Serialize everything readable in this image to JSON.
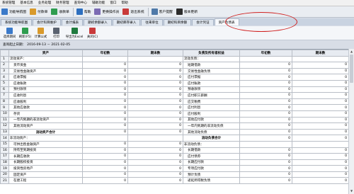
{
  "menubar": [
    "系统管理",
    "基本信息",
    "业务处理",
    "财务管理",
    "查询中心",
    "辅助功能",
    "窗口",
    "帮助"
  ],
  "toolbar": [
    {
      "name": "function-navigation-button",
      "label": "功能导航图",
      "icon": "grid-icon",
      "color": "#3a79c9"
    },
    {
      "name": "payment-button",
      "label": "付款单",
      "icon": "money-out-icon",
      "color": "#d99a2b"
    },
    {
      "name": "receipt-button",
      "label": "收款单",
      "icon": "money-in-icon",
      "color": "#2f9d4f"
    },
    {
      "name": "help-button",
      "label": "帮助",
      "icon": "help-icon",
      "color": "#2d6fbf"
    },
    {
      "name": "change-operator-button",
      "label": "更换操作员",
      "icon": "user-switch-icon",
      "color": "#7b6bb3"
    },
    {
      "name": "exit-system-button",
      "label": "退出系统",
      "icon": "exit-icon",
      "color": "#c93a3a"
    },
    {
      "name": "customer-reminder-button",
      "label": "客户提醒",
      "icon": "bell-icon",
      "color": "#4f79a8"
    },
    {
      "name": "version-update-button",
      "label": "版本更新",
      "icon": "update-icon",
      "color": "#2c2c2c"
    }
  ],
  "tabs": [
    {
      "label": "系统功能导航图",
      "active": false
    },
    {
      "label": "会计科目维护",
      "active": false
    },
    {
      "label": "会计报表",
      "active": false
    },
    {
      "label": "期初余额录入",
      "active": false
    },
    {
      "label": "期初库存录入",
      "active": false
    },
    {
      "label": "往来单位",
      "active": false
    },
    {
      "label": "期初科目余额",
      "active": false
    },
    {
      "label": "会计凭证",
      "active": false
    },
    {
      "label": "资产负债表",
      "active": true
    }
  ],
  "actionbar": [
    {
      "name": "select-period-button",
      "label": "选择期间",
      "icon": "calendar-icon",
      "color": "#3a79c9"
    },
    {
      "name": "refresh-button",
      "label": "刷新(F5)",
      "icon": "refresh-icon",
      "color": "#2f9d4f"
    },
    {
      "name": "formula-button",
      "label": "计算公式",
      "icon": "formula-icon",
      "color": "#d99a2b"
    },
    {
      "name": "print-button",
      "label": "打印",
      "icon": "printer-icon",
      "color": "#5a6270"
    },
    {
      "name": "export-excel-button",
      "label": "导出为Excel",
      "icon": "excel-icon",
      "color": "#1f7a3e"
    },
    {
      "name": "close-button",
      "label": "关闭(C)",
      "icon": "close-icon",
      "color": "#c93a3a"
    }
  ],
  "period": {
    "label": "查询起止日期：",
    "range": "2016-09-13 － 2021-02-05"
  },
  "table": {
    "headers": [
      "资产",
      "年初数",
      "期末数",
      "负债及所有者权益",
      "年初数",
      "期末数"
    ],
    "rows": [
      {
        "n": "1",
        "a": "流动资产：",
        "av": "",
        "ae": "",
        "l": "流动负债：",
        "lv": "",
        "le": "",
        "abold": false,
        "lbold": false,
        "aind": false,
        "lind": false
      },
      {
        "n": "2",
        "a": "货币资金",
        "av": "0",
        "ae": "0",
        "l": "短期借款",
        "lv": "0",
        "le": "0",
        "aind": true,
        "lind": true
      },
      {
        "n": "3",
        "a": "交易性金融资产",
        "av": "0",
        "ae": "0",
        "l": "交易性金融负债",
        "lv": "0",
        "le": "0",
        "aind": true,
        "lind": true
      },
      {
        "n": "4",
        "a": "应收票据",
        "av": "0",
        "ae": "0",
        "l": "应付票据",
        "lv": "0",
        "le": "0",
        "aind": true,
        "lind": true
      },
      {
        "n": "5",
        "a": "应收账款",
        "av": "0",
        "ae": "0",
        "l": "应付账款",
        "lv": "0",
        "le": "0",
        "aind": true,
        "lind": true
      },
      {
        "n": "6",
        "a": "预付款项",
        "av": "0",
        "ae": "0",
        "l": "预收款项",
        "lv": "0",
        "le": "0",
        "aind": true,
        "lind": true
      },
      {
        "n": "7",
        "a": "应收利息",
        "av": "0",
        "ae": "0",
        "l": "应付职工薪酬",
        "lv": "0",
        "le": "0",
        "aind": true,
        "lind": true
      },
      {
        "n": "8",
        "a": "应收股利",
        "av": "0",
        "ae": "0",
        "l": "应交税费",
        "lv": "0",
        "le": "0",
        "aind": true,
        "lind": true
      },
      {
        "n": "9",
        "a": "其他应收款",
        "av": "0",
        "ae": "0",
        "l": "应付利息",
        "lv": "0",
        "le": "0",
        "aind": true,
        "lind": true
      },
      {
        "n": "10",
        "a": "存货",
        "av": "0",
        "ae": "0",
        "l": "应付股利",
        "lv": "0",
        "le": "0",
        "aind": true,
        "lind": true
      },
      {
        "n": "11",
        "a": "一年内到期的非流动资产",
        "av": "0",
        "ae": "0",
        "l": "其他应付款",
        "lv": "0",
        "le": "0",
        "aind": true,
        "lind": true
      },
      {
        "n": "12",
        "a": "其他流动资产",
        "av": "0",
        "ae": "0",
        "l": "一年内到期的非流动负债",
        "lv": "0",
        "le": "0",
        "aind": true,
        "lind": true
      },
      {
        "n": "13",
        "a": "流动资产合计",
        "av": "0",
        "ae": "0",
        "l": "其他流动负债",
        "lv": "0",
        "le": "0",
        "abold": true,
        "lind": true
      },
      {
        "n": "14",
        "a": "非流动资产：",
        "av": "",
        "ae": "",
        "l": "流动负债合计",
        "lv": "0",
        "le": "0",
        "lbold": true
      },
      {
        "n": "15",
        "a": "可供出售金融资产",
        "av": "0",
        "ae": "0",
        "l": "非流动负债：",
        "lv": "",
        "le": "",
        "aind": true
      },
      {
        "n": "16",
        "a": "持有至到期投资",
        "av": "0",
        "ae": "0",
        "l": "长期借款",
        "lv": "0",
        "le": "0",
        "aind": true,
        "lind": true
      },
      {
        "n": "17",
        "a": "长期应收款",
        "av": "0",
        "ae": "0",
        "l": "应付债券",
        "lv": "0",
        "le": "0",
        "aind": true,
        "lind": true
      },
      {
        "n": "18",
        "a": "长期股权投资",
        "av": "0",
        "ae": "0",
        "l": "长期应付款",
        "lv": "0",
        "le": "0",
        "aind": true,
        "lind": true
      },
      {
        "n": "19",
        "a": "投资性房地产",
        "av": "0",
        "ae": "0",
        "l": "专项应付款",
        "lv": "0",
        "le": "0",
        "aind": true,
        "lind": true
      },
      {
        "n": "20",
        "a": "固定资产",
        "av": "0",
        "ae": "0",
        "l": "预计负债",
        "lv": "0",
        "le": "0",
        "aind": true,
        "lind": true
      },
      {
        "n": "21",
        "a": "在建工程",
        "av": "0",
        "ae": "0",
        "l": "递延所得税负债",
        "lv": "0",
        "le": "0",
        "aind": true,
        "lind": true
      }
    ]
  }
}
